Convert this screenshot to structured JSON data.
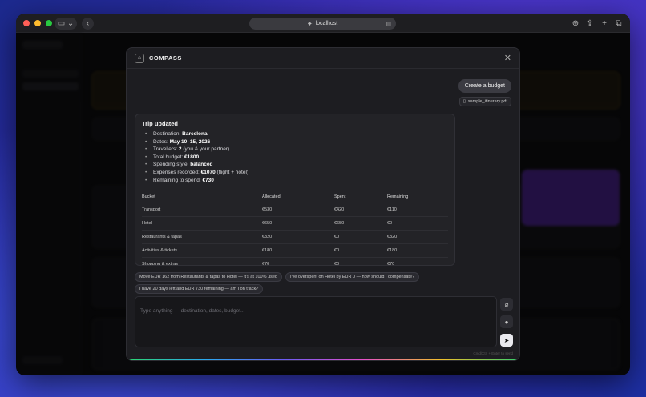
{
  "browser": {
    "url": "localhost"
  },
  "modal": {
    "brand": "COMPASS",
    "user_message": "Create a budget",
    "attachment": "sample_itinerary.pdf",
    "response": {
      "title": "Trip updated",
      "items": [
        {
          "label": "Destination: ",
          "value": "Barcelona",
          "suffix": ""
        },
        {
          "label": "Dates: ",
          "value": "May 10–15, 2026",
          "suffix": ""
        },
        {
          "label": "Travellers: ",
          "value": "2",
          "suffix": " (you & your partner)"
        },
        {
          "label": "Total budget: ",
          "value": "€1800",
          "suffix": ""
        },
        {
          "label": "Spending style: ",
          "value": "balanced",
          "suffix": ""
        },
        {
          "label": "Expenses recorded: ",
          "value": "€1070",
          "suffix": " (flight + hotel)"
        },
        {
          "label": "Remaining to spend: ",
          "value": "€730",
          "suffix": ""
        }
      ],
      "table": {
        "headers": [
          "Bucket",
          "Allocated",
          "Spent",
          "Remaining"
        ],
        "rows": [
          [
            "Transport",
            "€530",
            "€420",
            "€110"
          ],
          [
            "Hotel",
            "€650",
            "€650",
            "€0"
          ],
          [
            "Restaurants & tapas",
            "€320",
            "€0",
            "€320"
          ],
          [
            "Activities & tickets",
            "€180",
            "€0",
            "€180"
          ],
          [
            "Shopping & extras",
            "€70",
            "€0",
            "€70"
          ]
        ]
      }
    },
    "suggestions": [
      "Move EUR 162 from Restaurants & tapas to Hotel — it's at 100% used",
      "I've overspent on Hotel by EUR 0 — how should I compensate?",
      "I have 20 days left and EUR 730 remaining — am I on track?"
    ],
    "input_placeholder": "Type anything — destination, dates, budget...",
    "hint": "Cmd/Ctrl + Enter to send"
  },
  "colors": {
    "accent": "#7b3fe0"
  }
}
